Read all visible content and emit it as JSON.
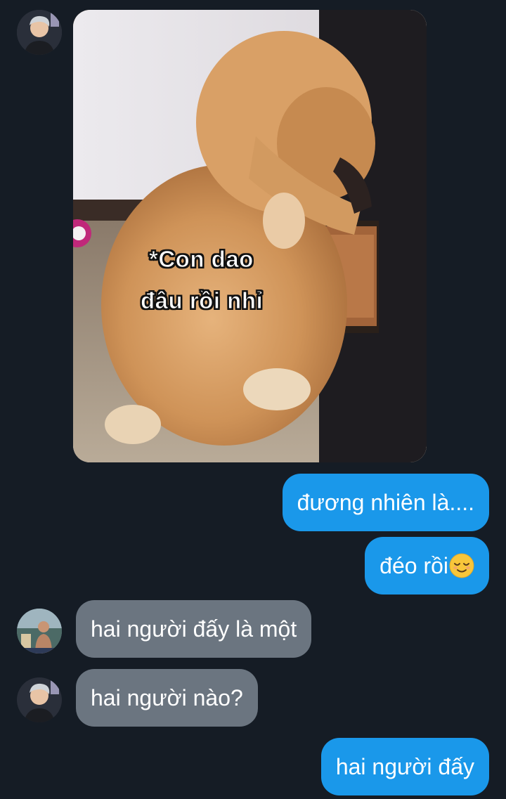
{
  "messages": {
    "image_caption_line1": "*Con dao",
    "image_caption_line2": "đâu rồi nhỉ",
    "sent_1": "đương nhiên là....",
    "sent_2_text": "đéo rồi",
    "sent_2_emoji": "relieved-face",
    "received_1": "hai người đấy là một",
    "received_2": "hai người nào?",
    "sent_3": "hai người đấy"
  },
  "colors": {
    "background": "#151c25",
    "sent_bubble": "#1a98ea",
    "received_bubble": "#6b7580",
    "text": "#ffffff"
  },
  "icons": {
    "avatar_1": "avatar-person-icon",
    "avatar_2": "avatar-person-icon",
    "avatar_3": "avatar-person-icon"
  }
}
